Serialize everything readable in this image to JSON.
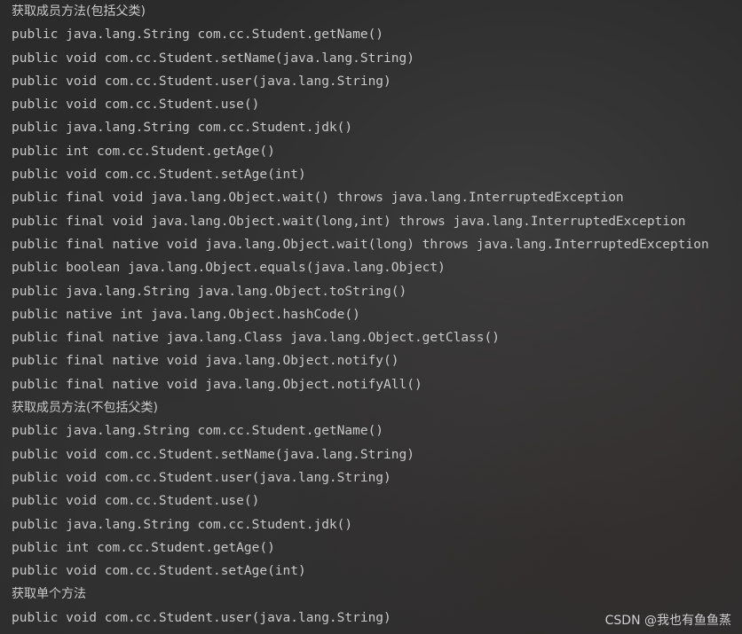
{
  "console": {
    "lines": [
      "获取成员方法(包括父类)",
      "public java.lang.String com.cc.Student.getName()",
      "public void com.cc.Student.setName(java.lang.String)",
      "public void com.cc.Student.user(java.lang.String)",
      "public void com.cc.Student.use()",
      "public java.lang.String com.cc.Student.jdk()",
      "public int com.cc.Student.getAge()",
      "public void com.cc.Student.setAge(int)",
      "public final void java.lang.Object.wait() throws java.lang.InterruptedException",
      "public final void java.lang.Object.wait(long,int) throws java.lang.InterruptedException",
      "public final native void java.lang.Object.wait(long) throws java.lang.InterruptedException",
      "public boolean java.lang.Object.equals(java.lang.Object)",
      "public java.lang.String java.lang.Object.toString()",
      "public native int java.lang.Object.hashCode()",
      "public final native java.lang.Class java.lang.Object.getClass()",
      "public final native void java.lang.Object.notify()",
      "public final native void java.lang.Object.notifyAll()",
      "获取成员方法(不包括父类)",
      "public java.lang.String com.cc.Student.getName()",
      "public void com.cc.Student.setName(java.lang.String)",
      "public void com.cc.Student.user(java.lang.String)",
      "public void com.cc.Student.use()",
      "public java.lang.String com.cc.Student.jdk()",
      "public int com.cc.Student.getAge()",
      "public void com.cc.Student.setAge(int)",
      "获取单个方法",
      "public void com.cc.Student.user(java.lang.String)"
    ]
  },
  "watermark": "CSDN @我也有鱼鱼蒸",
  "colors": {
    "background": "#2b2b2b",
    "text": "#c9c9c9"
  }
}
